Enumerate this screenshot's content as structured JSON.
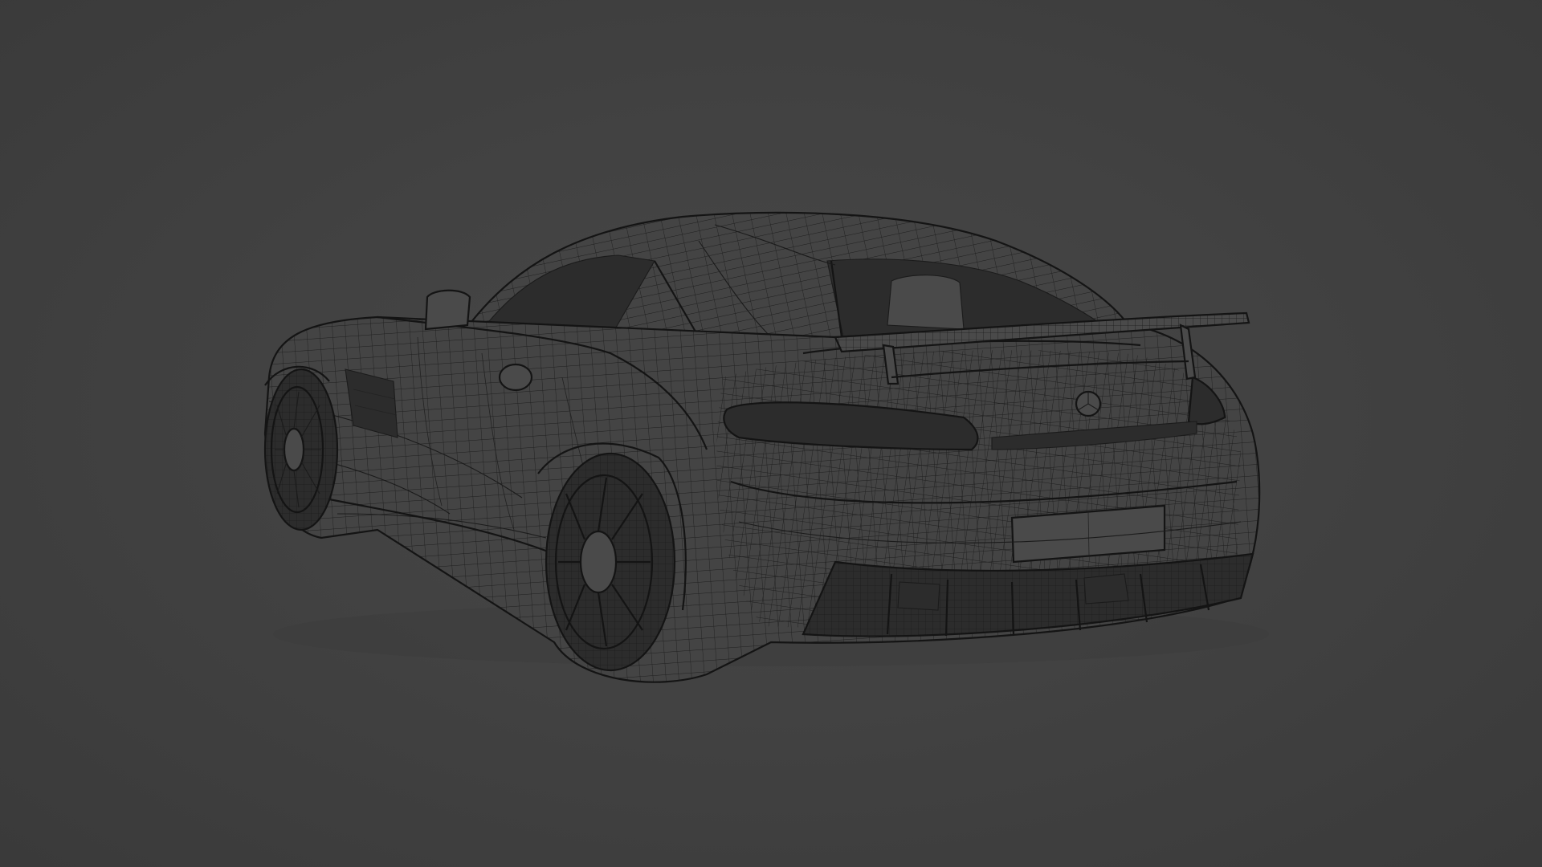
{
  "scene": {
    "background_color": "#404040",
    "wire_color": "#1b1b1b",
    "subject": "car-wireframe"
  }
}
